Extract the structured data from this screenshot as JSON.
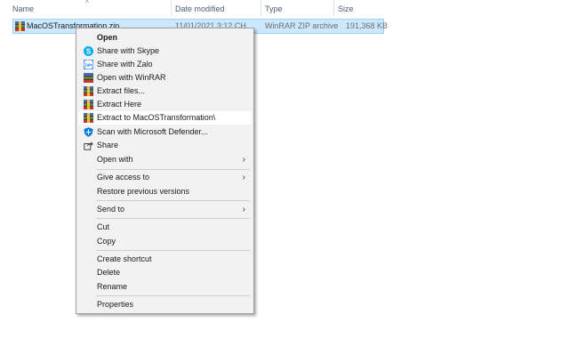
{
  "columns": {
    "name": "Name",
    "date_modified": "Date modified",
    "type": "Type",
    "size": "Size"
  },
  "file": {
    "name": "MacOSTransformation.zip",
    "date": "11/01/2021 3:12 CH",
    "type": "WinRAR ZIP archive",
    "size": "191,368 KB",
    "icon": "winrar-archive-icon"
  },
  "menu": {
    "open": "Open",
    "share_skype": "Share with Skype",
    "share_zalo": "Share with Zalo",
    "open_winrar": "Open with WinRAR",
    "extract_files": "Extract files...",
    "extract_here": "Extract Here",
    "extract_to": "Extract to MacOSTransformation\\",
    "scan_defender": "Scan with Microsoft Defender...",
    "share": "Share",
    "open_with": "Open with",
    "give_access": "Give access to",
    "restore_versions": "Restore previous versions",
    "send_to": "Send to",
    "cut": "Cut",
    "copy": "Copy",
    "create_shortcut": "Create shortcut",
    "delete": "Delete",
    "rename": "Rename",
    "properties": "Properties",
    "submenu_arrow": "›"
  },
  "colors": {
    "selection": "#cce8ff",
    "skype": "#00aff0",
    "zalo": "#0068ff",
    "defender": "#0078d7"
  }
}
